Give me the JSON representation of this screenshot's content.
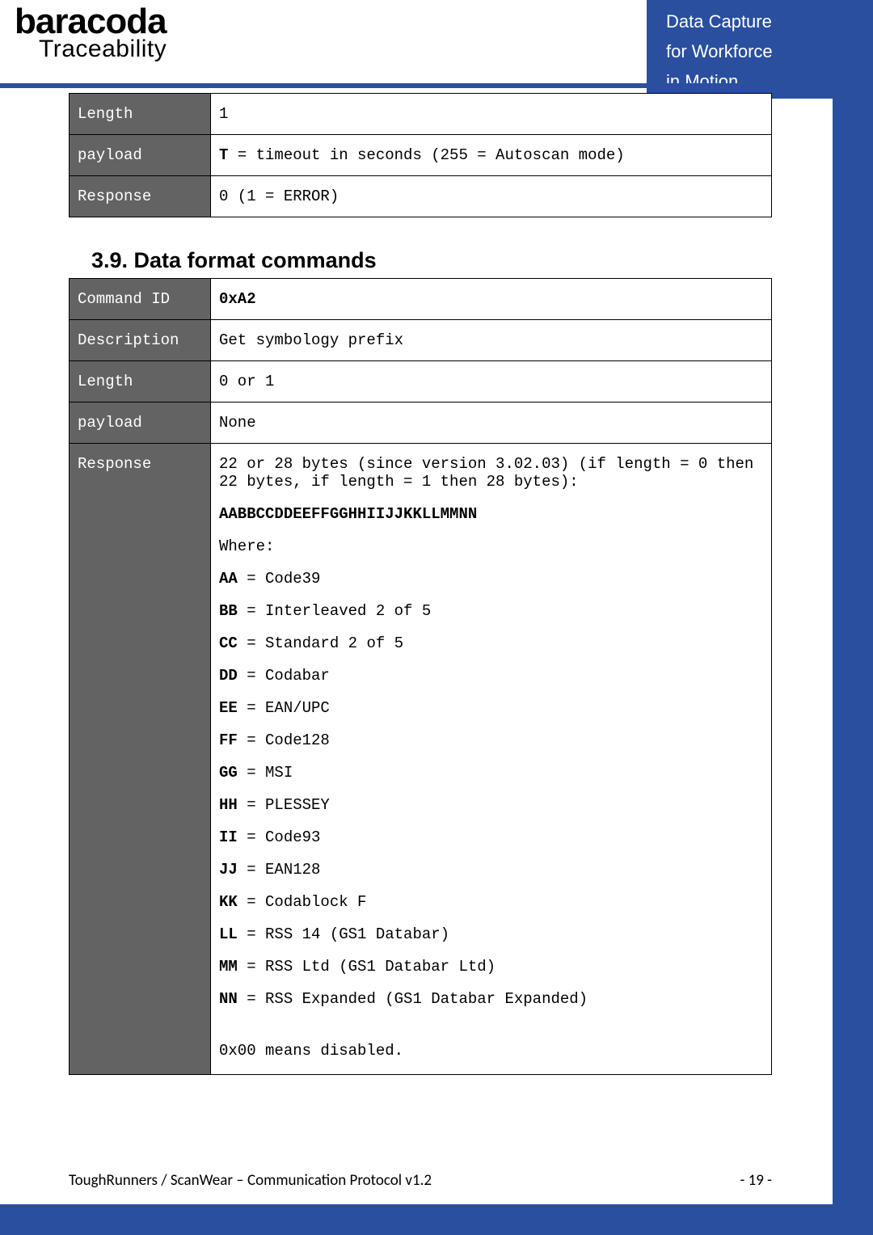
{
  "logo": {
    "name": "baracoda",
    "tagline": "Traceability"
  },
  "header": {
    "line1": "Data Capture",
    "line2": "for Workforce",
    "line3": "in Motion"
  },
  "table1": {
    "length_label": "Length",
    "length_value": "1",
    "payload_label": "payload",
    "payload_bold": "T",
    "payload_rest": " = timeout in seconds (255 = Autoscan mode)",
    "response_label": "Response",
    "response_value": "0 (1 = ERROR)"
  },
  "section_title": "3.9. Data format commands",
  "table2": {
    "cmdid_label": "Command ID",
    "cmdid_value": "0xA2",
    "desc_label": "Description",
    "desc_value": "Get symbology prefix",
    "length_label": "Length",
    "length_value": "0 or 1",
    "payload_label": "payload",
    "payload_value": "None",
    "response_label": "Response",
    "resp_line1": "22 or 28 bytes  (since version 3.02.03) (if length = 0 then 22 bytes, if length = 1 then 28 bytes):",
    "resp_pattern": "AABBCCDDEEFFGGHHIIJJKKLLMMNN",
    "resp_where": "Where:",
    "AA_b": "AA",
    "AA_r": " = Code39",
    "BB_b": "BB",
    "BB_r": " = Interleaved 2 of 5",
    "CC_b": "CC",
    "CC_r": " = Standard 2 of 5",
    "DD_b": "DD",
    "DD_r": " = Codabar",
    "EE_b": "EE",
    "EE_r": " = EAN/UPC",
    "FF_b": "FF",
    "FF_r": " = Code128",
    "GG_b": "GG",
    "GG_r": " = MSI",
    "HH_b": "HH",
    "HH_r": " = PLESSEY",
    "II_b": "II",
    "II_r": " = Code93",
    "JJ_b": "JJ",
    "JJ_r": " = EAN128",
    "KK_b": "KK",
    "KK_r": " = Codablock F",
    "LL_b": "LL",
    "LL_r": " = RSS 14 (GS1 Databar)",
    "MM_b": "MM",
    "MM_r": " = RSS Ltd (GS1 Databar Ltd)",
    "NN_b": "NN",
    "NN_r": " = RSS Expanded (GS1 Databar Expanded)",
    "resp_footer": "0x00 means disabled."
  },
  "footer": {
    "left": "ToughRunners / ScanWear – Communication Protocol v1.2",
    "right": "- 19 -"
  }
}
